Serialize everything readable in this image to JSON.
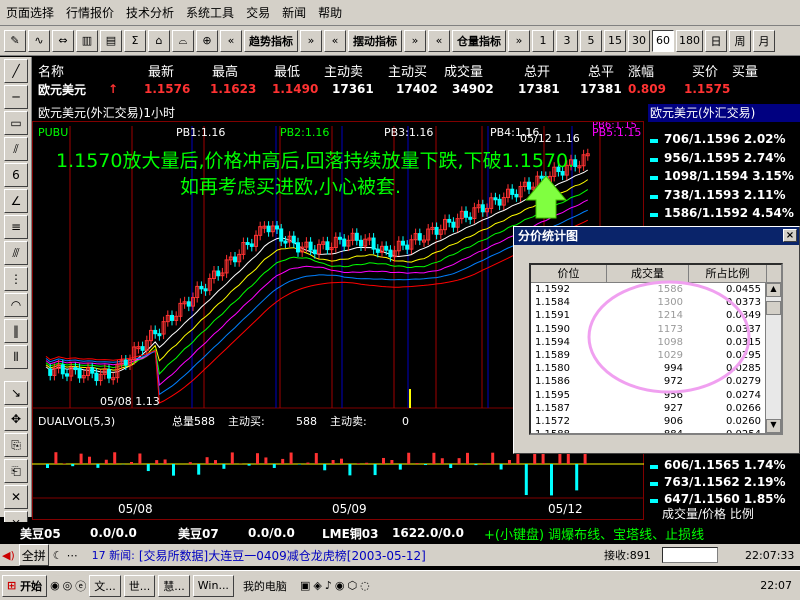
{
  "menu": [
    "页面选择",
    "行情报价",
    "技术分析",
    "系统工具",
    "交易",
    "新闻",
    "帮助"
  ],
  "toolbar": {
    "left_icons": [
      "pen-icon",
      "wave-icon",
      "arrows-icon",
      "bars-icon",
      "bars-down-icon",
      "sum-icon",
      "hat-icon",
      "hat-down-icon",
      "magnify-icon"
    ],
    "trend_label": "趋势指标",
    "swing_label": "摆动指标",
    "position_label": "仓量指标",
    "periods": [
      "1",
      "3",
      "5",
      "15",
      "30",
      "60",
      "180",
      "日",
      "周",
      "月"
    ],
    "selected_period": "60"
  },
  "quote": {
    "headers": [
      "名称",
      "最新",
      "最高",
      "最低",
      "主动卖",
      "主动买",
      "成交量",
      "总开",
      "总平",
      "涨幅",
      "买价",
      "买量"
    ],
    "name": "欧元美元",
    "arrow": "↑",
    "last": "1.1576",
    "high": "1.1623",
    "low": "1.1490",
    "active_sell": "17361",
    "active_buy": "17402",
    "volume": "34902",
    "total_open": "17381",
    "total_close": "17381",
    "change": "0.809",
    "bid": "1.1575"
  },
  "chart": {
    "title": "欧元美元(外汇交易)1小时",
    "pubu_label": "PUBU",
    "pb_labels": [
      "PB1:1.16",
      "PB2:1.16",
      "PB3:1.16",
      "PB4:1.16",
      "PB5:1.15"
    ],
    "pb_extra": "PB6:1.15",
    "date_marker": "05/12 1.16",
    "low_marker": "05/08 1.13",
    "annotation_line1": "1.1570放大量后,价格冲高后,回落持续放量下跌,下破1.1570.",
    "annotation_line2": "如再考虑买进欧,小心被套.",
    "vol_indicator": "DUALVOL(5,3)",
    "vol_total_label": "总量:",
    "vol_total": "588",
    "vol_buy_label": "主动买:",
    "vol_buy": "588",
    "vol_sell_label": "主动卖:",
    "vol_sell": "0",
    "x_dates": [
      "05/08",
      "05/09",
      "05/12"
    ],
    "colors": {
      "up": "#ff3232",
      "down": "#00ffff",
      "frame": "#800000",
      "annotation": "#00ff00"
    }
  },
  "side": {
    "title": "欧元美元(外汇交易)",
    "rows_top": [
      {
        "vol": "706",
        "price": "1.1596",
        "pct": "2.02%"
      },
      {
        "vol": "956",
        "price": "1.1595",
        "pct": "2.74%"
      },
      {
        "vol": "1098",
        "price": "1.1594",
        "pct": "3.15%"
      },
      {
        "vol": "738",
        "price": "1.1593",
        "pct": "2.11%"
      },
      {
        "vol": "1586",
        "price": "1.1592",
        "pct": "4.54%"
      },
      {
        "vol": "1214",
        "price": "1.1591",
        "pct": "3.48%"
      }
    ],
    "rows_bottom": [
      {
        "vol": "606",
        "price": "1.1565",
        "pct": "1.74%"
      },
      {
        "vol": "763",
        "price": "1.1562",
        "pct": "2.19%"
      },
      {
        "vol": "647",
        "price": "1.1560",
        "pct": "1.85%"
      }
    ],
    "footer": "成交量/价格 比例"
  },
  "dialog": {
    "title": "分价统计图",
    "close": "×",
    "headers": [
      "价位",
      "成交量",
      "所占比例"
    ],
    "rows": [
      [
        "1.1592",
        "1586",
        "0.0455"
      ],
      [
        "1.1584",
        "1300",
        "0.0373"
      ],
      [
        "1.1591",
        "1214",
        "0.0349"
      ],
      [
        "1.1590",
        "1173",
        "0.0337"
      ],
      [
        "1.1594",
        "1098",
        "0.0315"
      ],
      [
        "1.1589",
        "1029",
        "0.0295"
      ],
      [
        "1.1580",
        "994",
        "0.0285"
      ],
      [
        "1.1586",
        "972",
        "0.0279"
      ],
      [
        "1.1595",
        "956",
        "0.0274"
      ],
      [
        "1.1587",
        "927",
        "0.0266"
      ],
      [
        "1.1572",
        "906",
        "0.0260"
      ],
      [
        "1.1588",
        "884",
        "0.0254"
      ]
    ]
  },
  "bottom": {
    "items": [
      {
        "name": "美豆05",
        "value": "0.0/0.0"
      },
      {
        "name": "美豆07",
        "value": "0.0/0.0"
      },
      {
        "name": "LME铜03",
        "value": "1622.0/0.0"
      }
    ],
    "hint": "+(小键盘) 调爆布线、宝塔线、止损线"
  },
  "news": {
    "all_label": "全拼",
    "prefix": "17 新闻:",
    "text": "[交易所数据]大连豆一0409减仓龙虎榜[2003-05-12]",
    "receive": "接收:891",
    "time": "22:07:33"
  },
  "taskbar": {
    "start": "开始",
    "tasks": [
      "文...",
      "世...",
      "慧...",
      "Win..."
    ],
    "mycomputer": "我的电脑",
    "clock": "22:07"
  }
}
